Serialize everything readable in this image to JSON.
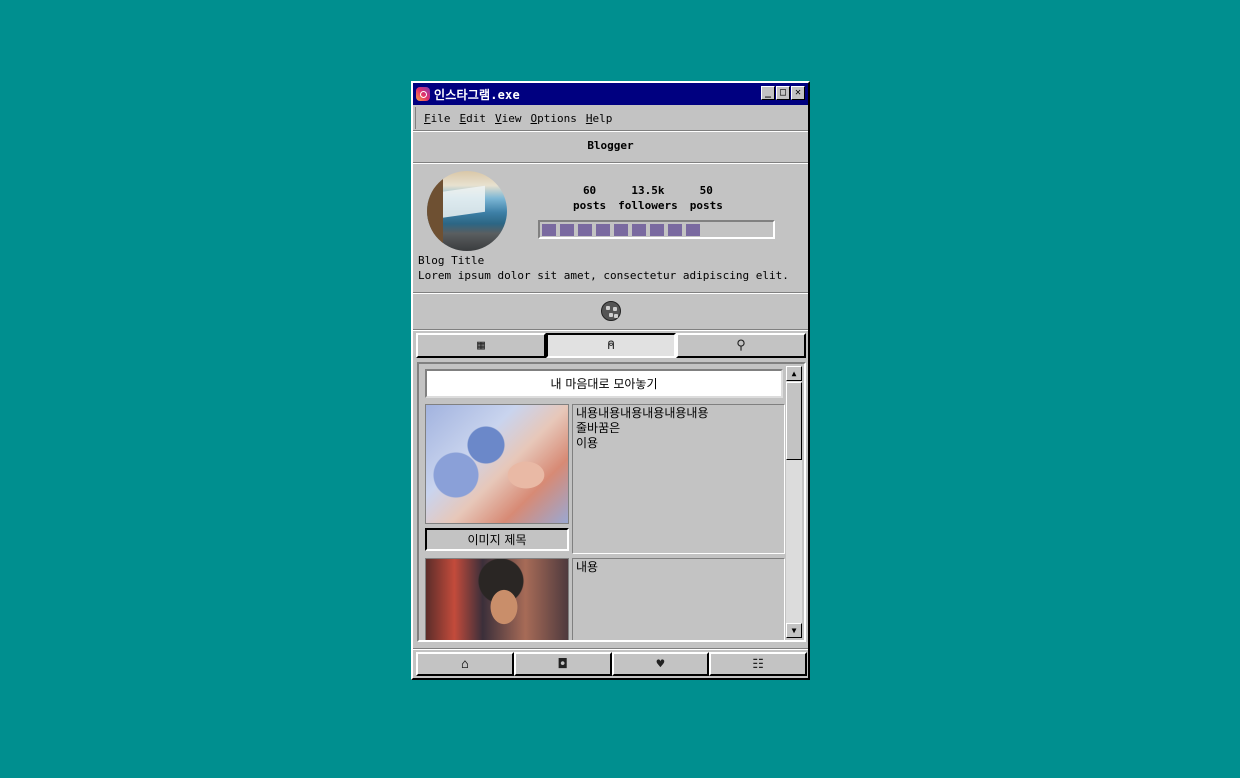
{
  "window": {
    "title": "인스타그램.exe",
    "minimize": "_",
    "maximize": "□",
    "close": "✕"
  },
  "menu": {
    "items": [
      {
        "u": "F",
        "rest": "ile"
      },
      {
        "u": "E",
        "rest": "dit"
      },
      {
        "u": "V",
        "rest": "iew"
      },
      {
        "u": "O",
        "rest": "ptions"
      },
      {
        "u": "H",
        "rest": "elp"
      }
    ]
  },
  "profile": {
    "username": "Blogger",
    "stats": [
      {
        "value": "60",
        "label": "posts"
      },
      {
        "value": "13.5k",
        "label": "followers"
      },
      {
        "value": "50",
        "label": "posts"
      }
    ],
    "progress": 0.68,
    "blog_title": "Blog Title",
    "bio": "Lorem ipsum dolor sit amet, consectetur adipiscing elit."
  },
  "tabs": [
    {
      "icon": "grid-icon",
      "glyph": "▦"
    },
    {
      "icon": "user-icon",
      "glyph": "⍝"
    },
    {
      "icon": "pin-icon",
      "glyph": "⚲"
    }
  ],
  "feed": {
    "header": "내 마음대로 모아놓기",
    "posts": [
      {
        "caption": "이미지 제목",
        "text": "내용내용내용내용내용내용\n줄바꿈은\n이용"
      },
      {
        "text": "내용"
      }
    ]
  },
  "scrollbar": {
    "up": "▲",
    "down": "▼"
  },
  "bottom_nav": [
    {
      "icon": "home-icon",
      "glyph": "⌂"
    },
    {
      "icon": "camera-icon",
      "glyph": "◘"
    },
    {
      "icon": "heart-icon",
      "glyph": "♥"
    },
    {
      "icon": "chat-icon",
      "glyph": "☷"
    }
  ],
  "colors": {
    "desktop": "#008f8f",
    "titlebar": "#000080",
    "window": "#c3c3c3",
    "progress": "#7a6aa0"
  }
}
